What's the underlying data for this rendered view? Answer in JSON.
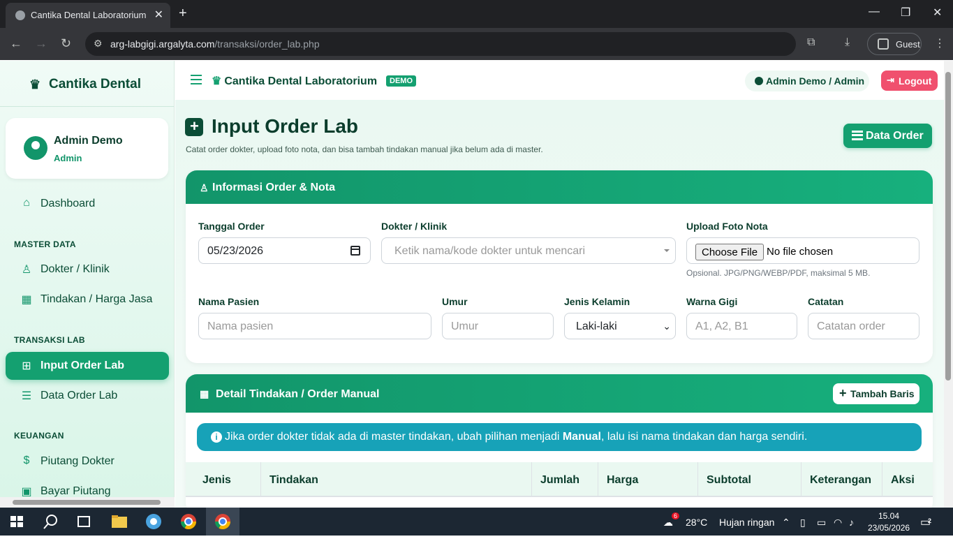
{
  "browser": {
    "tab_title": "Cantika Dental Laboratorium",
    "url_host": "arg-labgigi.argalyta.com",
    "url_path": "/transaksi/order_lab.php",
    "profile": "Guest"
  },
  "sidebar": {
    "brand": "Cantika Dental",
    "user_name": "Admin Demo",
    "user_role": "Admin",
    "dashboard": "Dashboard",
    "sections": {
      "master": "MASTER DATA",
      "transaksi": "TRANSAKSI LAB",
      "keuangan": "KEUANGAN"
    },
    "items": {
      "dokter": "Dokter / Klinik",
      "tindakan": "Tindakan / Harga Jasa",
      "input_order": "Input Order Lab",
      "data_order": "Data Order Lab",
      "piutang": "Piutang Dokter",
      "bayar": "Bayar Piutang"
    }
  },
  "topbar": {
    "title": "Cantika Dental Laboratorium",
    "badge": "DEMO",
    "user": "Admin Demo / Admin",
    "logout": "Logout"
  },
  "page": {
    "title": "Input Order Lab",
    "subtitle": "Catat order dokter, upload foto nota, dan bisa tambah tindakan manual jika belum ada di master.",
    "data_order_button": "Data Order"
  },
  "order_form": {
    "header": "Informasi Order & Nota",
    "tanggal_label": "Tanggal Order",
    "tanggal_value": "05/23/2026",
    "dokter_label": "Dokter / Klinik",
    "dokter_placeholder": "Ketik nama/kode dokter untuk mencari",
    "upload_label": "Upload Foto Nota",
    "upload_button": "Choose File",
    "upload_status": "No file chosen",
    "upload_help": "Opsional. JPG/PNG/WEBP/PDF, maksimal 5 MB.",
    "pasien_label": "Nama Pasien",
    "pasien_placeholder": "Nama pasien",
    "umur_label": "Umur",
    "umur_placeholder": "Umur",
    "jk_label": "Jenis Kelamin",
    "jk_value": "Laki-laki",
    "warna_label": "Warna Gigi",
    "warna_placeholder": "A1, A2, B1",
    "catatan_label": "Catatan",
    "catatan_placeholder": "Catatan order"
  },
  "detail": {
    "header": "Detail Tindakan / Order Manual",
    "add_row": "Tambah Baris",
    "info_pre": "Jika order dokter tidak ada di master tindakan, ubah pilihan menjadi ",
    "info_bold": "Manual",
    "info_post": ", lalu isi nama tindakan dan harga sendiri.",
    "columns": [
      "Jenis",
      "Tindakan",
      "Jumlah",
      "Harga",
      "Subtotal",
      "Keterangan",
      "Aksi"
    ]
  },
  "taskbar": {
    "weather_temp": "28°C",
    "weather_desc": "Hujan ringan",
    "weather_badge": "6",
    "time": "15.04",
    "date": "23/05/2026",
    "notif_count": "2"
  }
}
